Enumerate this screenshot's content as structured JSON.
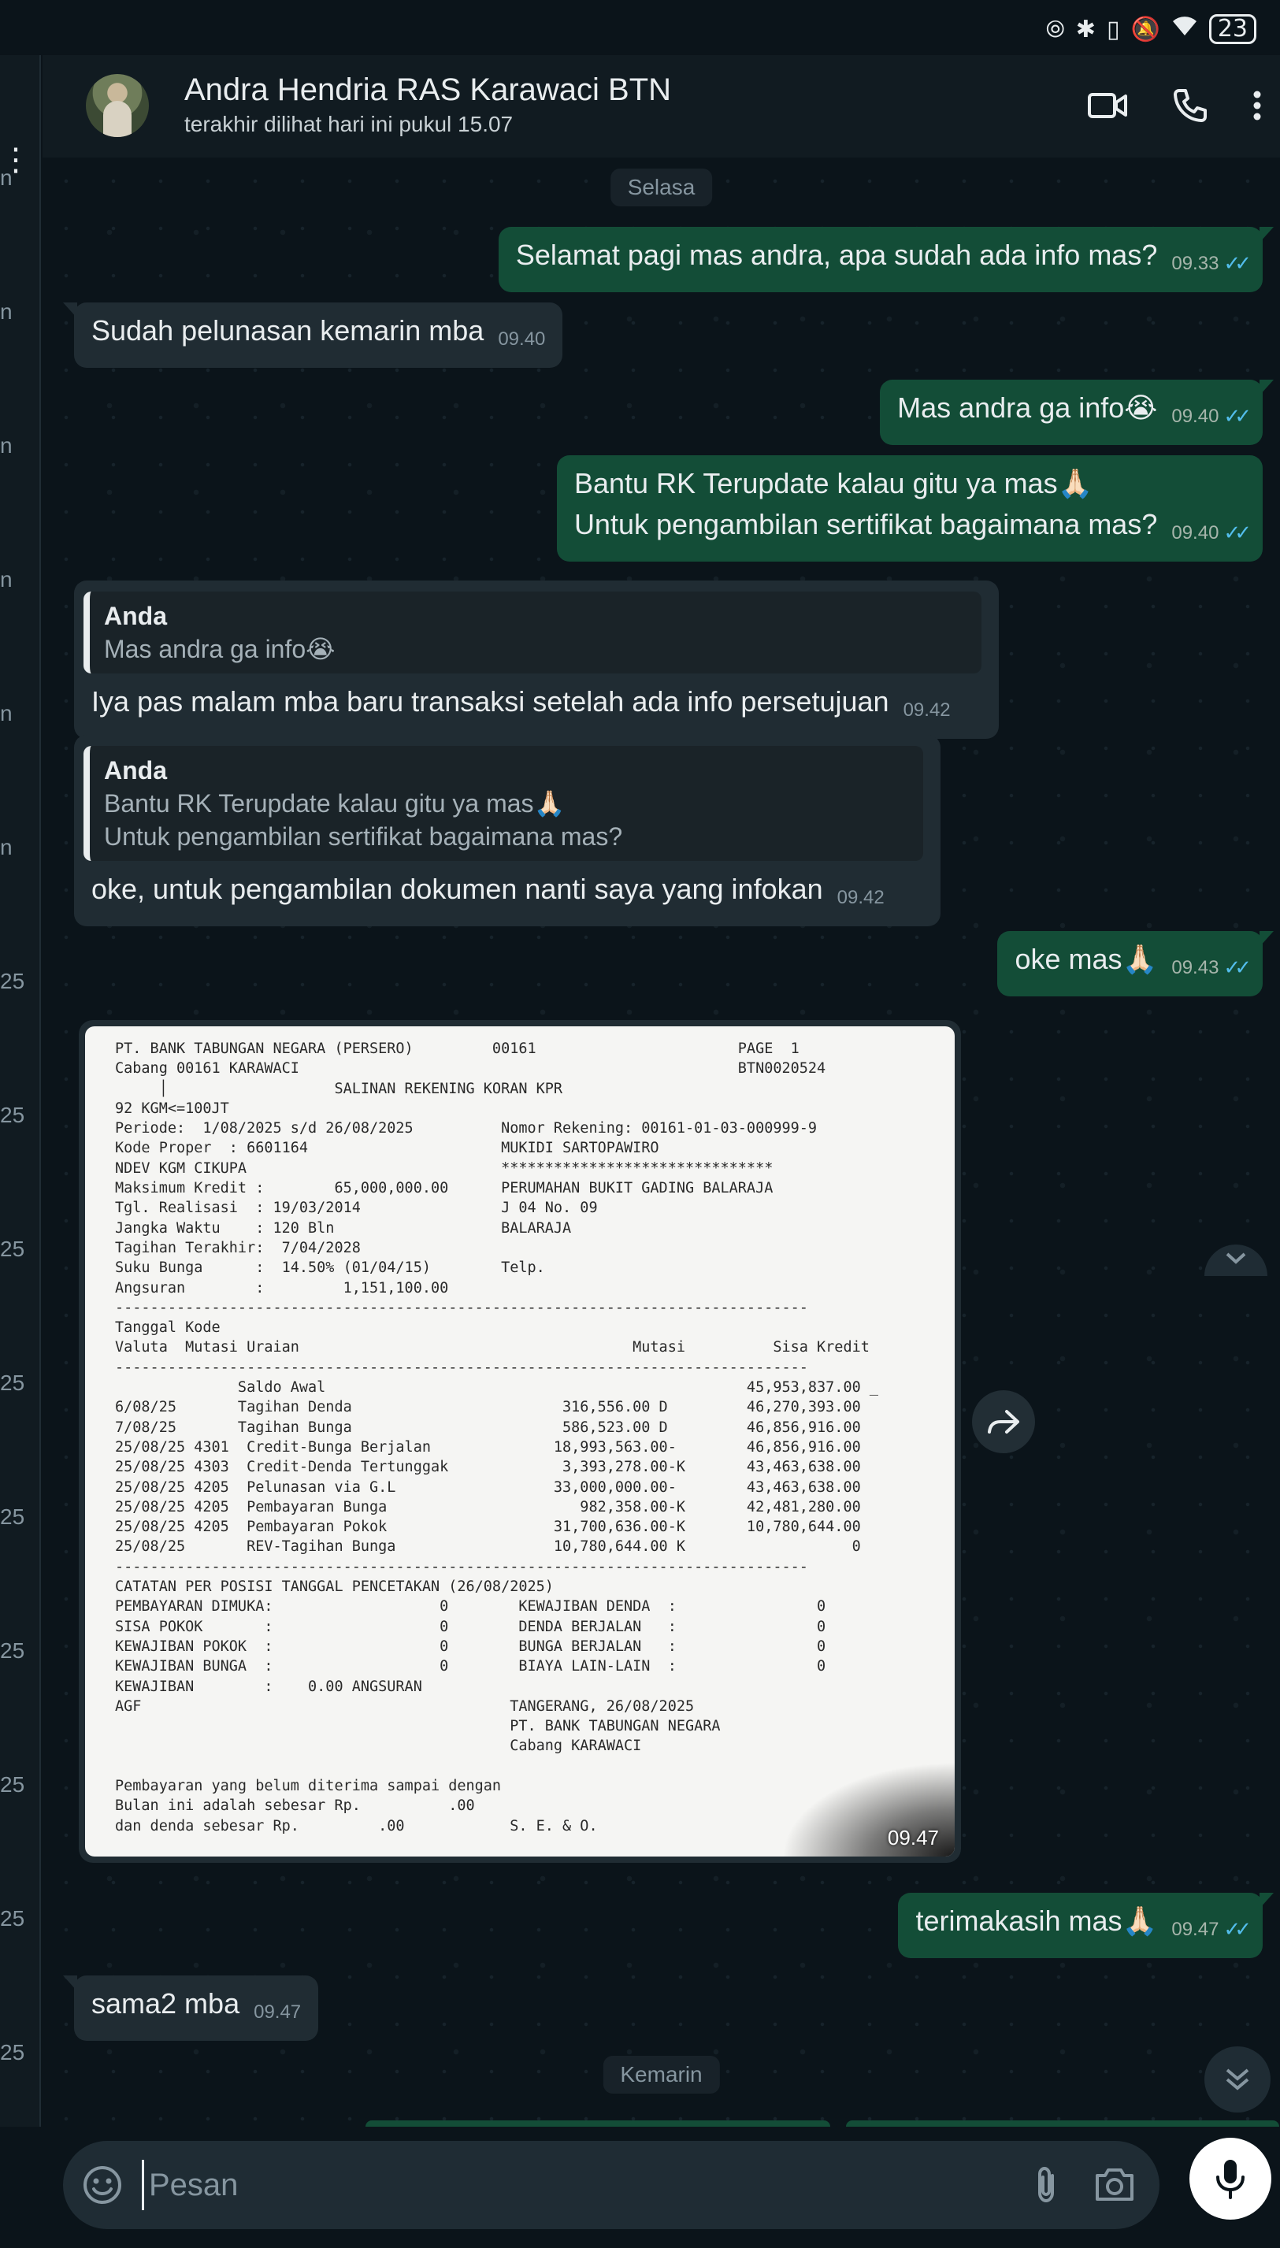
{
  "status_bar": {
    "icons": [
      "nfc-icon",
      "bluetooth-icon",
      "vibrate-icon",
      "mute-icon",
      "wifi-icon"
    ],
    "battery": "23"
  },
  "left_sliver": {
    "fragments": [
      "n",
      "n",
      "n",
      "n",
      "n",
      "n",
      "25",
      "25",
      "25",
      "25",
      "25",
      "25",
      "25",
      "25",
      "25"
    ]
  },
  "header": {
    "contact_name": "Andra Hendria RAS Karawaci BTN",
    "contact_status": "terakhir dilihat hari ini pukul 15.07"
  },
  "chat": {
    "date_selasa": "Selasa",
    "date_kemarin": "Kemarin",
    "messages": [
      {
        "text": "Selamat pagi mas andra, apa sudah ada info mas?",
        "time": "09.33"
      },
      {
        "text": "Sudah pelunasan kemarin mba",
        "time": "09.40"
      },
      {
        "text": "Mas andra ga info😭",
        "time": "09.40"
      },
      {
        "line1": "Bantu RK Terupdate kalau gitu ya mas🙏🏻",
        "line2": "Untuk pengambilan sertifikat bagaimana mas?",
        "time": "09.40"
      },
      {
        "quote_name": "Anda",
        "quote_text": "Mas andra ga info😭",
        "text": "Iya pas malam mba baru transaksi setelah ada info persetujuan",
        "time": "09.42"
      },
      {
        "quote_name": "Anda",
        "quote_line1": "Bantu RK Terupdate kalau gitu ya mas🙏🏻",
        "quote_line2": "Untuk pengambilan sertifikat bagaimana mas?",
        "text": "oke, untuk pengambilan dokumen nanti saya yang infokan",
        "time": "09.42"
      },
      {
        "text": "oke mas🙏🏻",
        "time": "09.43"
      },
      {
        "image_time": "09.47"
      },
      {
        "text": "terimakasih mas🙏🏻",
        "time": "09.47"
      },
      {
        "text": "sama2 mba",
        "time": "09.47"
      }
    ]
  },
  "document": {
    "lines": [
      "PT. BANK TABUNGAN NEGARA (PERSERO)         00161                       PAGE  1",
      "Cabang 00161 KARAWACI                                                  BTN0020524",
      "     │                   SALINAN REKENING KORAN KPR",
      "92 KGM<=100JT",
      "Periode:  1/08/2025 s/d 26/08/2025          Nomor Rekening: 00161-01-03-000999-9",
      "Kode Proper  : 6601164                      MUKIDI SARTOPAWIRO",
      "NDEV KGM CIKUPA                             *******************************",
      "Maksimum Kredit :        65,000,000.00      PERUMAHAN BUKIT GADING BALARAJA",
      "Tgl. Realisasi  : 19/03/2014                J 04 No. 09",
      "Jangka Waktu    : 120 Bln                   BALARAJA",
      "Tagihan Terakhir:  7/04/2028",
      "Suku Bunga      :  14.50% (01/04/15)        Telp.",
      "Angsuran        :         1,151,100.00",
      "-------------------------------------------------------------------------------",
      "Tanggal Kode",
      "Valuta  Mutasi Uraian                                      Mutasi          Sisa Kredit",
      "-------------------------------------------------------------------------------",
      "              Saldo Awal                                                45,953,837.00 _",
      "6/08/25       Tagihan Denda                        316,556.00 D         46,270,393.00",
      "7/08/25       Tagihan Bunga                        586,523.00 D         46,856,916.00",
      "25/08/25 4301  Credit-Bunga Berjalan              18,993,563.00-        46,856,916.00",
      "25/08/25 4303  Credit-Denda Tertunggak             3,393,278.00-K       43,463,638.00",
      "25/08/25 4205  Pelunasan via G.L                  33,000,000.00-        43,463,638.00",
      "25/08/25 4205  Pembayaran Bunga                      982,358.00-K       42,481,280.00",
      "25/08/25 4205  Pembayaran Pokok                   31,700,636.00-K       10,780,644.00",
      "25/08/25       REV-Tagihan Bunga                  10,780,644.00 K                   0",
      "-------------------------------------------------------------------------------",
      "CATATAN PER POSISI TANGGAL PENCETAKAN (26/08/2025)",
      "PEMBAYARAN DIMUKA:                   0        KEWAJIBAN DENDA  :                0",
      "SISA POKOK       :                   0        DENDA BERJALAN   :                0",
      "KEWAJIBAN POKOK  :                   0        BUNGA BERJALAN   :                0",
      "KEWAJIBAN BUNGA  :                   0        BIAYA LAIN-LAIN  :                0",
      "KEWAJIBAN        :    0.00 ANGSURAN",
      "AGF                                          TANGERANG, 26/08/2025",
      "                                             PT. BANK TABUNGAN NEGARA",
      "                                             Cabang KARAWACI",
      "",
      "Pembayaran yang belum diterima sampai dengan",
      "Bulan ini adalah sebesar Rp.          .00",
      "dan denda sebesar Rp.         .00            S. E. & O."
    ]
  },
  "input": {
    "placeholder": "Pesan"
  },
  "colors": {
    "outgoing_bubble": "#134d37",
    "incoming_bubble": "#202c33",
    "background": "#0b141a",
    "read_ticks": "#53bdeb"
  }
}
